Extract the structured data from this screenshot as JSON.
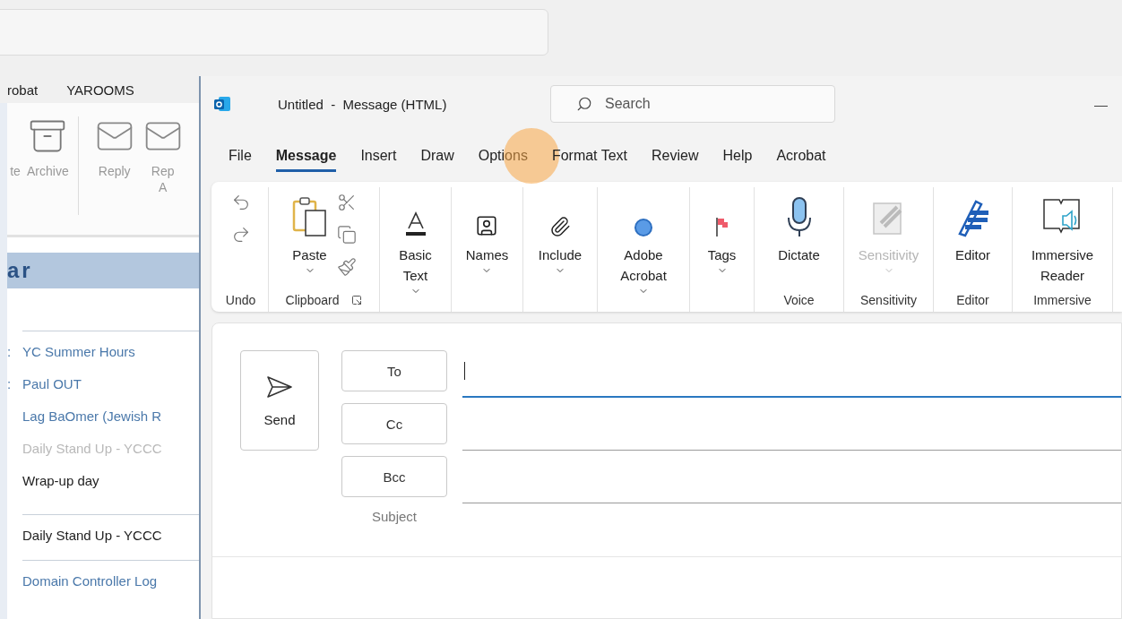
{
  "background_app": {
    "tabs": [
      "robat",
      "YAROOMS"
    ],
    "ribbon_buttons": [
      {
        "label": "te"
      },
      {
        "label": "Archive"
      },
      {
        "label": "Reply"
      },
      {
        "label": "Rep\nA"
      }
    ],
    "header": "ar",
    "calendar_groups": [
      {
        "items": [
          {
            "prefix": ":",
            "title": "YC Summer Hours",
            "color": "#4a78aa"
          },
          {
            "prefix": ":",
            "title": "Paul OUT",
            "color": "#4a78aa"
          },
          {
            "title": "Lag BaOmer (Jewish R",
            "color": "#4a78aa"
          },
          {
            "title": "Daily Stand Up - YCCC",
            "color": "#b9b9b9"
          },
          {
            "title": "Wrap-up day",
            "color": "#222222"
          }
        ]
      },
      {
        "items": [
          {
            "title": "Daily Stand Up - YCCC",
            "color": "#222222"
          }
        ]
      },
      {
        "items": [
          {
            "title": "Domain Controller Log",
            "color": "#4a78aa"
          }
        ]
      }
    ]
  },
  "window": {
    "title": "Untitled  -  Message (HTML)",
    "search": {
      "placeholder": "Search"
    },
    "minimize": "—"
  },
  "tabs": [
    {
      "label": "File",
      "selected": false,
      "highlighted": false
    },
    {
      "label": "Message",
      "selected": true,
      "highlighted": false
    },
    {
      "label": "Insert",
      "selected": false,
      "highlighted": false
    },
    {
      "label": "Draw",
      "selected": false,
      "highlighted": false
    },
    {
      "label": "Options",
      "selected": false,
      "highlighted": true
    },
    {
      "label": "Format Text",
      "selected": false,
      "highlighted": false
    },
    {
      "label": "Review",
      "selected": false,
      "highlighted": false
    },
    {
      "label": "Help",
      "selected": false,
      "highlighted": false
    },
    {
      "label": "Acrobat",
      "selected": false,
      "highlighted": false
    }
  ],
  "ribbon": {
    "groups": [
      {
        "label": "Undo",
        "launcher": false,
        "buttons": [
          {
            "kind": "small",
            "disabled": false
          },
          {
            "kind": "small",
            "disabled": false
          }
        ]
      },
      {
        "label": "Clipboard",
        "launcher": true,
        "buttons": [
          {
            "kind": "large",
            "lines": [
              "Paste"
            ],
            "dropdown": true,
            "disabled": false
          },
          {
            "kind": "small",
            "disabled": false
          },
          {
            "kind": "small",
            "disabled": false
          },
          {
            "kind": "small",
            "disabled": false
          }
        ]
      },
      {
        "launcher": false,
        "buttons": [
          {
            "kind": "large",
            "lines": [
              "Basic",
              "Text"
            ],
            "dropdown": true,
            "disabled": false
          }
        ]
      },
      {
        "launcher": false,
        "buttons": [
          {
            "kind": "large",
            "lines": [
              "Names"
            ],
            "dropdown": true,
            "disabled": false
          }
        ]
      },
      {
        "launcher": false,
        "buttons": [
          {
            "kind": "large",
            "lines": [
              "Include"
            ],
            "dropdown": true,
            "disabled": false
          }
        ]
      },
      {
        "launcher": false,
        "buttons": [
          {
            "kind": "large",
            "lines": [
              "Adobe",
              "Acrobat"
            ],
            "dropdown": true,
            "disabled": false
          }
        ]
      },
      {
        "launcher": false,
        "buttons": [
          {
            "kind": "large",
            "lines": [
              "Tags"
            ],
            "dropdown": true,
            "disabled": false
          }
        ]
      },
      {
        "label": "Voice",
        "launcher": false,
        "buttons": [
          {
            "kind": "large",
            "lines": [
              "Dictate"
            ],
            "dropdown": false,
            "disabled": false
          }
        ]
      },
      {
        "label": "Sensitivity",
        "launcher": false,
        "buttons": [
          {
            "kind": "large",
            "lines": [
              "Sensitivity"
            ],
            "dropdown": true,
            "disabled": true
          }
        ]
      },
      {
        "label": "Editor",
        "launcher": false,
        "buttons": [
          {
            "kind": "large",
            "lines": [
              "Editor"
            ],
            "dropdown": false,
            "disabled": false
          }
        ]
      },
      {
        "label": "Immersive",
        "launcher": false,
        "buttons": [
          {
            "kind": "large",
            "lines": [
              "Immersive",
              "Reader"
            ],
            "dropdown": false,
            "disabled": false
          }
        ]
      }
    ]
  },
  "compose": {
    "send": "Send",
    "recipients": [
      {
        "label": "To",
        "focused": true
      },
      {
        "label": "Cc",
        "focused": false
      },
      {
        "label": "Bcc",
        "focused": false
      }
    ],
    "subject_label": "Subject"
  }
}
